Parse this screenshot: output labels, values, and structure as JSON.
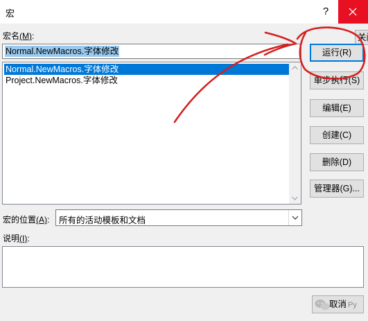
{
  "window": {
    "title": "宏",
    "help_label": "?"
  },
  "macro_name": {
    "label": "宏名",
    "accel": "(M)",
    "label_suffix": ":",
    "value": "Normal.NewMacros.字体修改"
  },
  "macro_list": [
    {
      "label": "Normal.NewMacros.字体修改",
      "selected": true
    },
    {
      "label": "Project.NewMacros.字体修改",
      "selected": false
    }
  ],
  "buttons": {
    "partial_label": "关闭",
    "run": "运行(R)",
    "step": "单步执行(S)",
    "edit": "编辑(E)",
    "create": "创建(C)",
    "delete": "删除(D)",
    "organizer": "管理器(G)...",
    "cancel": "取消"
  },
  "location": {
    "label": "宏的位置",
    "accel": "(A)",
    "label_suffix": ":",
    "value": "所有的活动模板和文档"
  },
  "description": {
    "label": "说明",
    "accel": "(I)",
    "label_suffix": ":"
  },
  "watermark": {
    "text": "Py"
  },
  "colors": {
    "selection": "#0078d7",
    "annotation": "#d42020",
    "close": "#e81123"
  }
}
